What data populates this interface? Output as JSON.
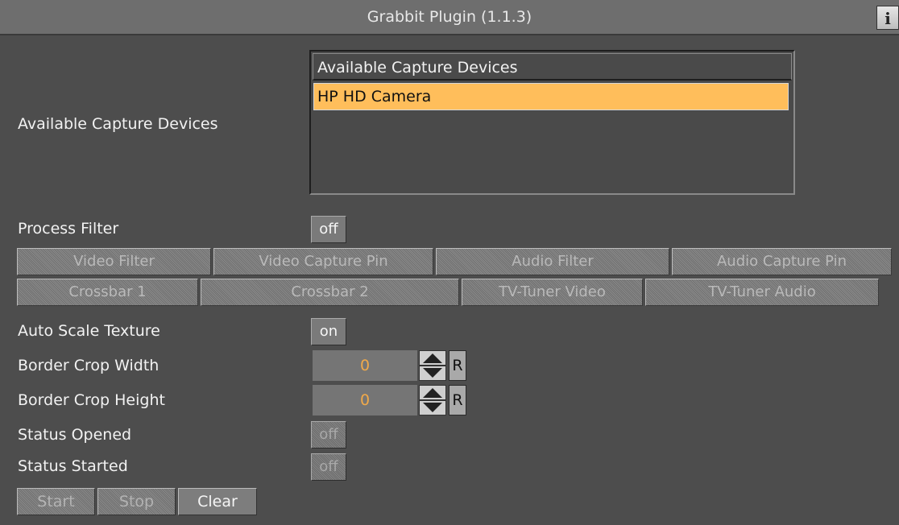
{
  "window": {
    "title": "Grabbit Plugin (1.1.3)",
    "info_label": "i"
  },
  "capture_devices": {
    "label": "Available Capture Devices",
    "list_header": "Available Capture Devices",
    "items": [
      {
        "label": "HP HD Camera",
        "selected": true
      }
    ],
    "selected_color": "#ffbe5b"
  },
  "process_filter": {
    "label": "Process Filter",
    "value": "off"
  },
  "filter_buttons_row1": [
    "Video Filter",
    "Video Capture Pin",
    "Audio Filter",
    "Audio Capture Pin"
  ],
  "filter_buttons_row2": [
    "Crossbar 1",
    "Crossbar 2",
    "TV-Tuner Video",
    "TV-Tuner Audio"
  ],
  "auto_scale_texture": {
    "label": "Auto Scale Texture",
    "value": "on"
  },
  "border_crop_width": {
    "label": "Border Crop Width",
    "value": "0",
    "reset_label": "R"
  },
  "border_crop_height": {
    "label": "Border Crop Height",
    "value": "0",
    "reset_label": "R"
  },
  "status_opened": {
    "label": "Status Opened",
    "value": "off"
  },
  "status_started": {
    "label": "Status Started",
    "value": "off"
  },
  "actions": {
    "start": "Start",
    "stop": "Stop",
    "clear": "Clear"
  }
}
